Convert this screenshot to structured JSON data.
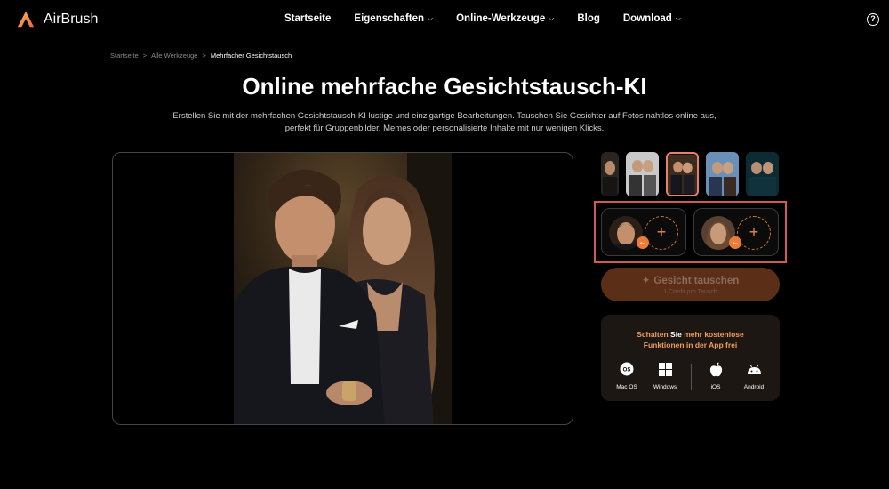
{
  "brand": {
    "name": "AirBrush"
  },
  "nav": {
    "items": [
      {
        "label": "Startseite",
        "dropdown": false
      },
      {
        "label": "Eigenschaften",
        "dropdown": true
      },
      {
        "label": "Online-Werkzeuge",
        "dropdown": true
      },
      {
        "label": "Blog",
        "dropdown": false
      },
      {
        "label": "Download",
        "dropdown": true
      }
    ],
    "help_icon": "question-circle-icon"
  },
  "breadcrumb": {
    "home": "Startseite",
    "tools": "Alle Werkzeuge",
    "current": "Mehrfacher Gesichtstausch",
    "separator": ">"
  },
  "page": {
    "title": "Online mehrfache Gesichtstausch-KI",
    "description_line1": "Erstellen Sie mit der mehrfachen Gesichtstausch-KI lustige und einzigartige Bearbeitungen. Tauschen Sie Gesichter auf Fotos nahtlos online aus,",
    "description_line2": "perfekt für Gruppenbilder, Memes oder personalisierte Inhalte mit nur wenigen Klicks."
  },
  "faces": {
    "add_symbol": "+",
    "arrow_symbol": "←"
  },
  "swap": {
    "label": "Gesicht tauschen",
    "sub_label": "1 Credit pro Tausch"
  },
  "promo": {
    "line1_orange": "Schalten",
    "line1_white": "Sie",
    "line1_rest": "mehr kostenlose",
    "line2": "Funktionen in der App frei",
    "platforms": [
      "Mac OS",
      "Windows",
      "iOS",
      "Android"
    ]
  },
  "colors": {
    "accent": "#ec7c3a",
    "highlight_border": "#d25a50",
    "swap_button": "#5b2e18"
  }
}
